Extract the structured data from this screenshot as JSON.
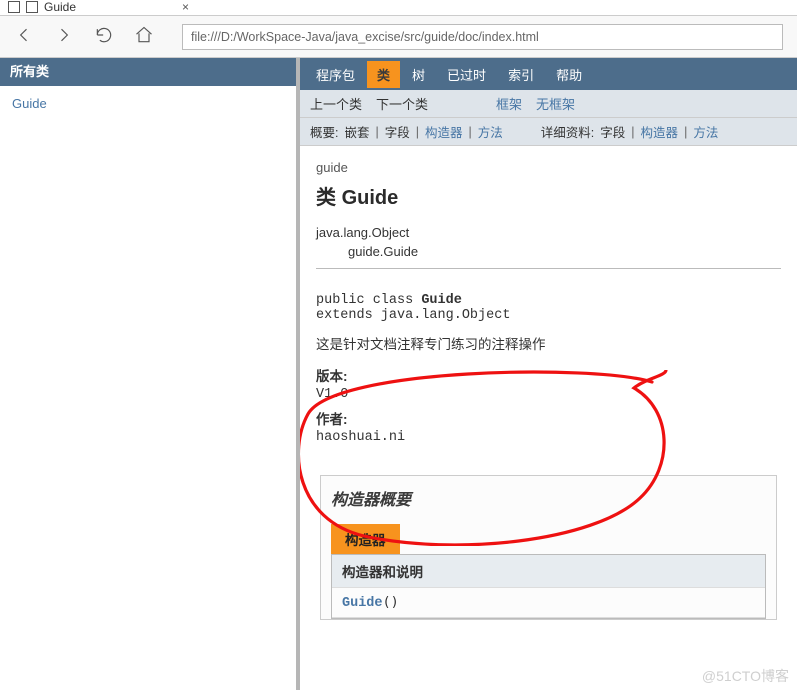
{
  "browser": {
    "tab_title": "Guide",
    "url": "file:///D:/WorkSpace-Java/java_excise/src/guide/doc/index.html"
  },
  "left": {
    "header": "所有类",
    "items": [
      "Guide"
    ]
  },
  "tabs": {
    "package": "程序包",
    "class": "类",
    "tree": "树",
    "deprecated": "已过时",
    "index": "索引",
    "help": "帮助"
  },
  "subnav1": {
    "prev": "上一个类",
    "next": "下一个类",
    "frames": "框架",
    "noframes": "无框架"
  },
  "subnav2": {
    "summary_label": "概要:",
    "summary_items": {
      "nested": "嵌套",
      "field": "字段",
      "constr": "构造器",
      "method": "方法"
    },
    "detail_label": "详细资料:",
    "detail_items": {
      "field": "字段",
      "constr": "构造器",
      "method": "方法"
    }
  },
  "doc": {
    "package": "guide",
    "heading_prefix": "类 ",
    "heading_name": "Guide",
    "hierarchy": {
      "root": "java.lang.Object",
      "leaf": "guide.Guide"
    },
    "signature": {
      "line1_pre": "public class ",
      "line1_name": "Guide",
      "line2": "extends java.lang.Object"
    },
    "description": "这是针对文档注释专门练习的注释操作",
    "version_label": "版本:",
    "version_value": "V1.0",
    "author_label": "作者:",
    "author_value": "haoshuai.ni"
  },
  "constructor_summary": {
    "title": "构造器概要",
    "badge": "构造器",
    "col_head": "构造器和说明",
    "row1_name": "Guide",
    "row1_paren": "()"
  },
  "watermark": "@51CTO博客"
}
